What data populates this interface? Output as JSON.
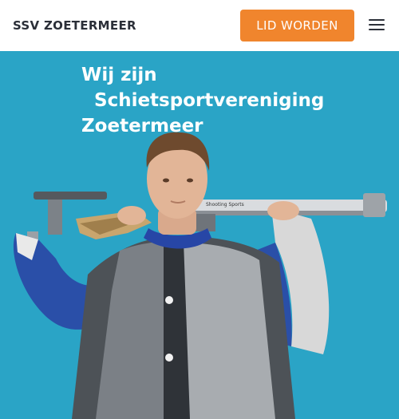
{
  "header": {
    "brand": "SSV ZOETERMEER",
    "cta_label": "LID WORDEN",
    "menu_icon": "hamburger-menu-icon"
  },
  "hero": {
    "title_line1": "Wij zijn",
    "title_line2": "Schietsportvereniging",
    "title_line3": "Zoetermeer",
    "rifle_label": "Shooting Sports",
    "background_color": "#2aa4c6"
  },
  "colors": {
    "accent": "#f0852d",
    "brand_text": "#2b2f38",
    "hero_bg": "#2aa4c6"
  }
}
